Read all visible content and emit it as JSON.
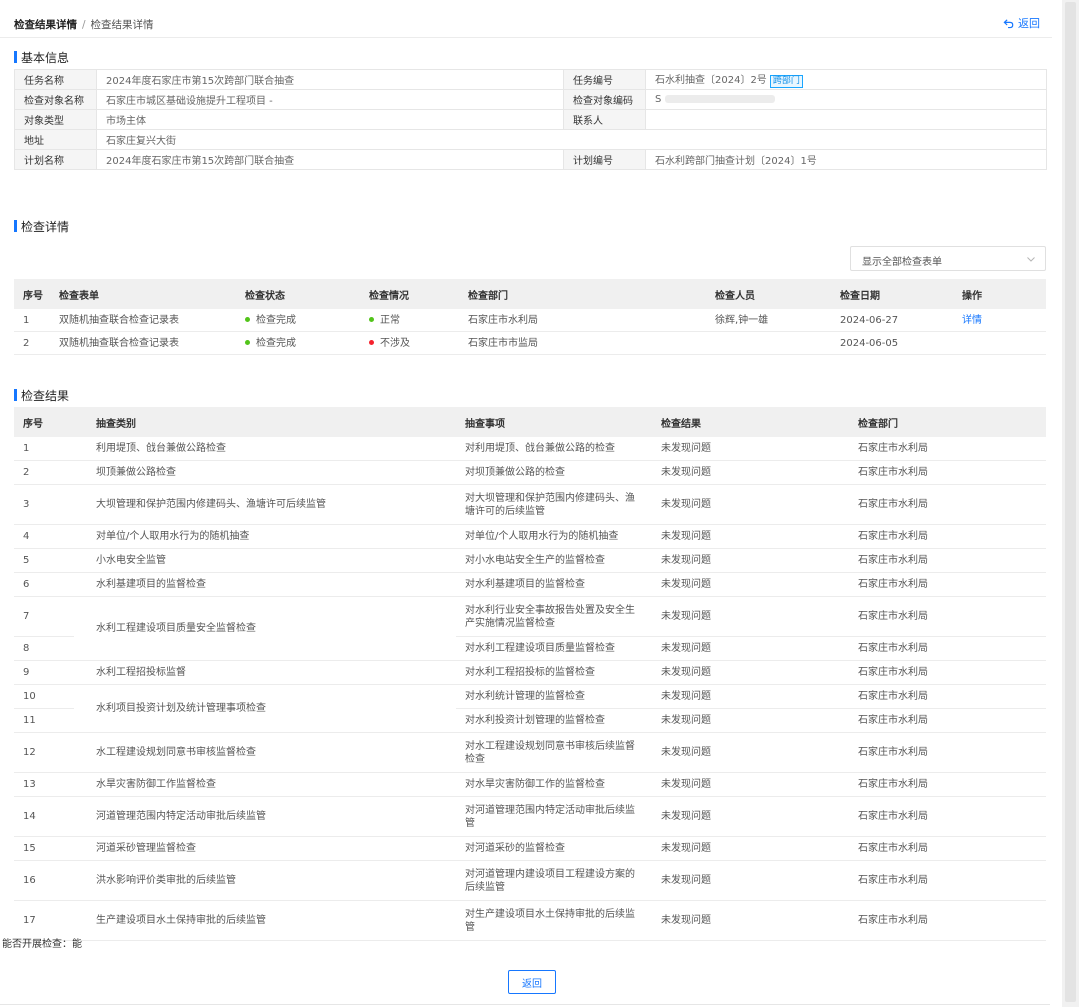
{
  "breadcrumb": {
    "first": "检查结果详情",
    "sep": "/",
    "last": "检查结果详情"
  },
  "header": {
    "back_label": "返回"
  },
  "basic": {
    "title": "基本信息",
    "task_name_label": "任务名称",
    "task_name": "2024年度石家庄市第15次跨部门联合抽查",
    "task_no_label": "任务编号",
    "task_no": "石水利抽查〔2024〕2号",
    "task_tag": "跨部门",
    "object_name_label": "检查对象名称",
    "object_name": "石家庄市城区基础设施提升工程项目 -",
    "object_code_label": "检查对象编码",
    "object_code": "S",
    "object_type_label": "对象类型",
    "object_type": "市场主体",
    "contact_label": "联系人",
    "contact": "",
    "address_label": "地址",
    "address": "石家庄复兴大街",
    "plan_name_label": "计划名称",
    "plan_name": "2024年度石家庄市第15次跨部门联合抽查",
    "plan_no_label": "计划编号",
    "plan_no": "石水利跨部门抽查计划〔2024〕1号"
  },
  "detail": {
    "title": "检查详情",
    "filter_value": "显示全部检查表单",
    "headers": [
      "序号",
      "检查表单",
      "检查状态",
      "检查情况",
      "检查部门",
      "检查人员",
      "检查日期",
      "操作"
    ],
    "rows": [
      {
        "no": "1",
        "form": "双随机抽查联合检查记录表",
        "status": "检查完成",
        "situation": "正常",
        "dept": "石家庄市水利局",
        "people": "徐辉,钟一雄",
        "date": "2024-06-27",
        "op": "详情"
      },
      {
        "no": "2",
        "form": "双随机抽查联合检查记录表",
        "status": "检查完成",
        "situation": "不涉及",
        "dept": "石家庄市市监局",
        "people": "",
        "date": "2024-06-05",
        "op": ""
      }
    ]
  },
  "colors": {
    "accent": "#1677ff",
    "ok": "#52c41a",
    "na": "#f5222d"
  },
  "results": {
    "title": "检查结果",
    "headers": [
      "序号",
      "抽查类别",
      "抽查事项",
      "检查结果",
      "检查部门"
    ],
    "rows": [
      {
        "no": "1",
        "category": "利用堤顶、戗台兼做公路检查",
        "item": "对利用堤顶、戗台兼做公路的检查",
        "result": "未发现问题",
        "dept": "石家庄市水利局"
      },
      {
        "no": "2",
        "category": "坝顶兼做公路检查",
        "item": "对坝顶兼做公路的检查",
        "result": "未发现问题",
        "dept": "石家庄市水利局"
      },
      {
        "no": "3",
        "category": "大坝管理和保护范围内修建码头、渔塘许可后续监管",
        "item": "对大坝管理和保护范围内修建码头、渔塘许可的后续监管",
        "result": "未发现问题",
        "dept": "石家庄市水利局"
      },
      {
        "no": "4",
        "category": "对单位/个人取用水行为的随机抽查",
        "item": "对单位/个人取用水行为的随机抽查",
        "result": "未发现问题",
        "dept": "石家庄市水利局"
      },
      {
        "no": "5",
        "category": "小水电安全监管",
        "item": "对小水电站安全生产的监督检查",
        "result": "未发现问题",
        "dept": "石家庄市水利局"
      },
      {
        "no": "6",
        "category": "水利基建项目的监督检查",
        "item": "对水利基建项目的监督检查",
        "result": "未发现问题",
        "dept": "石家庄市水利局"
      },
      {
        "no": "7",
        "category": "水利工程建设项目质量安全监督检查",
        "item": "对水利行业安全事故报告处置及安全生产实施情况监督检查",
        "result": "未发现问题",
        "dept": "石家庄市水利局"
      },
      {
        "no": "8",
        "category": "",
        "item": "对水利工程建设项目质量监督检查",
        "result": "未发现问题",
        "dept": "石家庄市水利局"
      },
      {
        "no": "9",
        "category": "水利工程招投标监督",
        "item": "对水利工程招投标的监督检查",
        "result": "未发现问题",
        "dept": "石家庄市水利局"
      },
      {
        "no": "10",
        "category": "水利项目投资计划及统计管理事项检查",
        "item": "对水利统计管理的监督检查",
        "result": "未发现问题",
        "dept": "石家庄市水利局"
      },
      {
        "no": "11",
        "category": "",
        "item": "对水利投资计划管理的监督检查",
        "result": "未发现问题",
        "dept": "石家庄市水利局"
      },
      {
        "no": "12",
        "category": "水工程建设规划同意书审核监督检查",
        "item": "对水工程建设规划同意书审核后续监督检查",
        "result": "未发现问题",
        "dept": "石家庄市水利局"
      },
      {
        "no": "13",
        "category": "水旱灾害防御工作监督检查",
        "item": "对水旱灾害防御工作的监督检查",
        "result": "未发现问题",
        "dept": "石家庄市水利局"
      },
      {
        "no": "14",
        "category": "河道管理范围内特定活动审批后续监管",
        "item": "对河道管理范围内特定活动审批后续监管",
        "result": "未发现问题",
        "dept": "石家庄市水利局"
      },
      {
        "no": "15",
        "category": "河道采砂管理监督检查",
        "item": "对河道采砂的监督检查",
        "result": "未发现问题",
        "dept": "石家庄市水利局"
      },
      {
        "no": "16",
        "category": "洪水影响评价类审批的后续监管",
        "item": "对河道管理内建设项目工程建设方案的后续监管",
        "result": "未发现问题",
        "dept": "石家庄市水利局"
      },
      {
        "no": "17",
        "category": "生产建设项目水土保持审批的后续监管",
        "item": "对生产建设项目水土保持审批的后续监管",
        "result": "未发现问题",
        "dept": "石家庄市水利局"
      }
    ]
  },
  "footer": {
    "can_inspect": "能否开展检查：能",
    "return_label": "返回"
  }
}
